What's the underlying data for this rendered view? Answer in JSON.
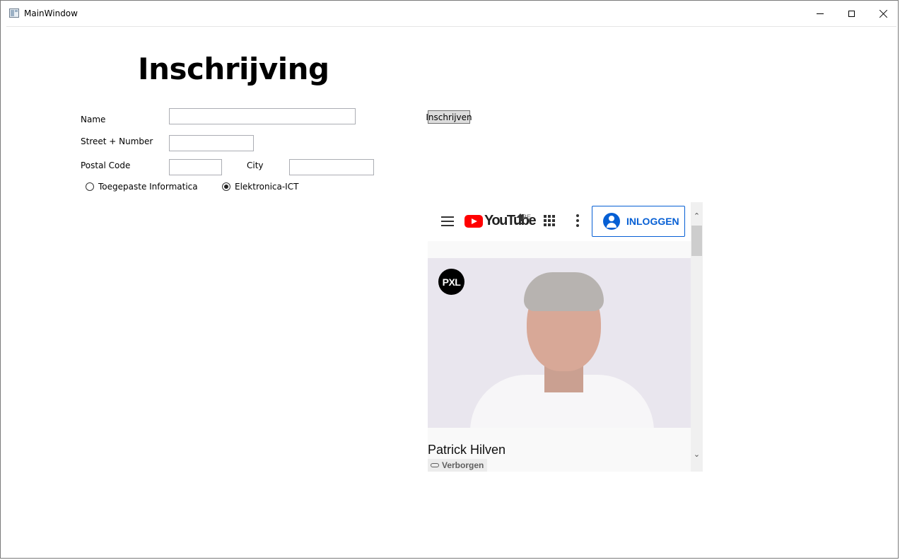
{
  "window": {
    "title": "MainWindow"
  },
  "form": {
    "heading": "Inschrijving",
    "name_label": "Name",
    "name_value": "",
    "street_label": "Street + Number",
    "street_value": "",
    "postal_label": "Postal Code",
    "postal_value": "",
    "city_label": "City",
    "city_value": "",
    "submit_label": "Inschrijven",
    "options": [
      {
        "label": "Toegepaste Informatica",
        "checked": false
      },
      {
        "label": "Elektronica-ICT",
        "checked": true
      }
    ]
  },
  "browser": {
    "logo_text": "YouTube",
    "region": "BE",
    "login_label": "INLOGGEN",
    "channel_logo": "PXL",
    "video_title": "Patrick Hilven",
    "visibility_badge": "Verborgen"
  },
  "icons": {
    "menu": "hamburger-icon",
    "upload": "upload-icon",
    "apps": "apps-grid-icon",
    "more": "more-vert-icon",
    "account": "account-icon",
    "link": "link-icon"
  },
  "colors": {
    "youtube_red": "#ff0000",
    "login_blue": "#065fd4"
  }
}
